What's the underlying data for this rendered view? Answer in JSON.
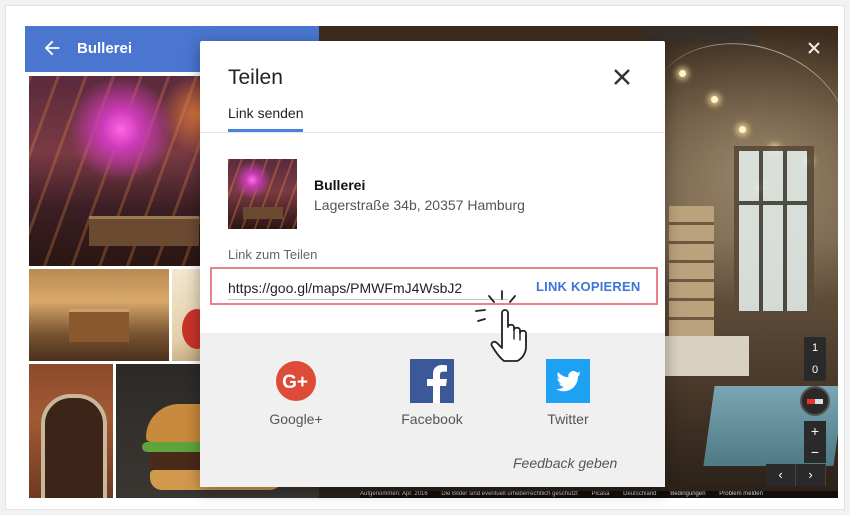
{
  "left_panel": {
    "title": "Bullerei"
  },
  "dialog": {
    "title": "Teilen",
    "tab_label": "Link senden",
    "place_name": "Bullerei",
    "place_address": "Lagerstraße 34b, 20357 Hamburg",
    "link_label": "Link zum Teilen",
    "link_value": "https://goo.gl/maps/PMWFmJ4WsbJ2",
    "copy_label": "LINK KOPIEREN",
    "social": [
      {
        "label": "Google+",
        "icon": "google-plus-icon",
        "color": "#dd4b39"
      },
      {
        "label": "Facebook",
        "icon": "facebook-icon",
        "color": "#3b5998"
      },
      {
        "label": "Twitter",
        "icon": "twitter-icon",
        "color": "#1da1f2"
      }
    ],
    "feedback_label": "Feedback geben"
  },
  "controls": {
    "level_top": "1",
    "level_bottom": "0",
    "zoom_in": "+",
    "zoom_out": "−",
    "prev": "‹",
    "next": "›"
  },
  "footer": {
    "captured": "Aufgenommen: Apr. 2016",
    "copyright": "Die Bilder sind eventuell urheberrechtlich geschützt",
    "picasa": "Picasa",
    "country": "Deutschland",
    "terms": "Bedingungen",
    "report": "Problem melden"
  },
  "colors": {
    "header_blue": "#4a76d0",
    "accent_blue": "#3f74d8",
    "tab_underline": "#4a84e0",
    "highlight_border": "#e8838a"
  }
}
